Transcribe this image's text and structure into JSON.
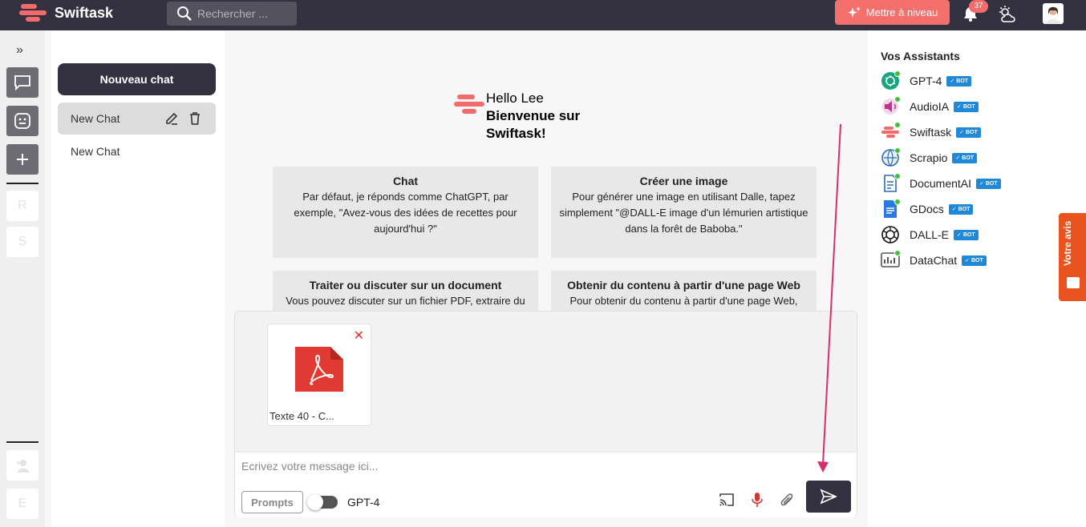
{
  "app": {
    "name": "Swiftask",
    "brand_color": "#f26b6b",
    "dark_color": "#33313f"
  },
  "header": {
    "search_placeholder": "Rechercher ...",
    "upgrade_label": "Mettre à niveau",
    "notification_count": "37"
  },
  "rail": {
    "items": [
      "R",
      "S",
      "E"
    ]
  },
  "chatlist": {
    "new_chat_label": "Nouveau chat",
    "chats": [
      {
        "label": "New Chat"
      },
      {
        "label": "New Chat"
      }
    ]
  },
  "hero": {
    "line1": "Hello Lee",
    "line2": "Bienvenue sur",
    "line3": "Swiftask!"
  },
  "cards": [
    {
      "title": "Chat",
      "body": "Par défaut, je réponds comme ChatGPT, par exemple, \"Avez-vous des idées de recettes pour aujourd'hui ?\""
    },
    {
      "title": "Créer une image",
      "body": "Pour générer une image en utilisant Dalle, tapez simplement \"@DALL-E image d'un lémurien artistique dans la forêt de Baboba.\""
    },
    {
      "title": "Traiter ou discuter sur un document",
      "body": "Vous pouvez discuter sur un fichier PDF, extraire du"
    },
    {
      "title": "Obtenir du contenu à partir d'une page Web",
      "body": "Pour obtenir du contenu à partir d'une page Web,"
    }
  ],
  "composer": {
    "file_name": "Texte 40 - C...",
    "placeholder": "Ecrivez votre message ici...",
    "prompts_label": "Prompts",
    "model": "GPT-4"
  },
  "assistants": {
    "title": "Vos Assistants",
    "badge": "BOT",
    "items": [
      {
        "name": "GPT-4",
        "icon": "openai-icon"
      },
      {
        "name": "AudioIA",
        "icon": "audio-icon"
      },
      {
        "name": "Swiftask",
        "icon": "swiftask-icon"
      },
      {
        "name": "Scrapio",
        "icon": "scrapio-icon"
      },
      {
        "name": "DocumentAI",
        "icon": "document-icon"
      },
      {
        "name": "GDocs",
        "icon": "gdocs-icon"
      },
      {
        "name": "DALL-E",
        "icon": "openai-icon"
      },
      {
        "name": "DataChat",
        "icon": "datachat-icon"
      }
    ]
  },
  "feedback": {
    "label": "Votre avis"
  }
}
